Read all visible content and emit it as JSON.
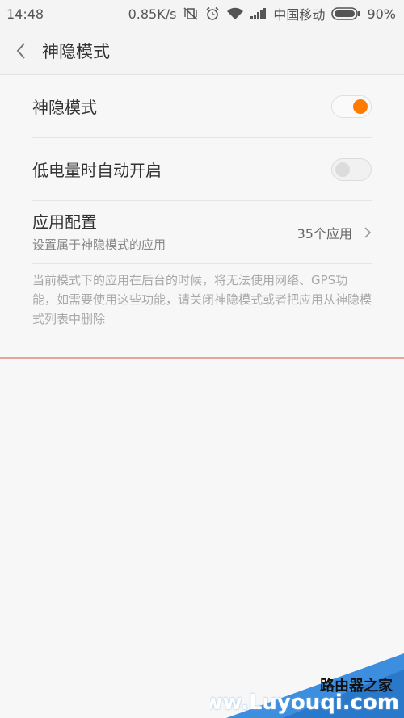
{
  "status_bar": {
    "time": "14:48",
    "speed": "0.85K/s",
    "carrier": "中国移动",
    "battery": "90%"
  },
  "header": {
    "title": "神隐模式"
  },
  "settings": {
    "stealth_mode_label": "神隐模式",
    "stealth_mode_enabled": true,
    "low_battery_label": "低电量时自动开启",
    "low_battery_enabled": false,
    "app_config_title": "应用配置",
    "app_config_subtitle": "设置属于神隐模式的应用",
    "app_config_count": "35个应用"
  },
  "description": "当前模式下的应用在后台的时候，将无法使用网络、GPS功能，如需要使用这些功能，请关闭神隐模式或者把应用从神隐模式列表中删除",
  "watermark": {
    "line1": "路由器之家",
    "line2": "Www.Luyouqi.com"
  },
  "colors": {
    "accent": "#ff7a00",
    "divider_highlight": "#e9a39b"
  }
}
